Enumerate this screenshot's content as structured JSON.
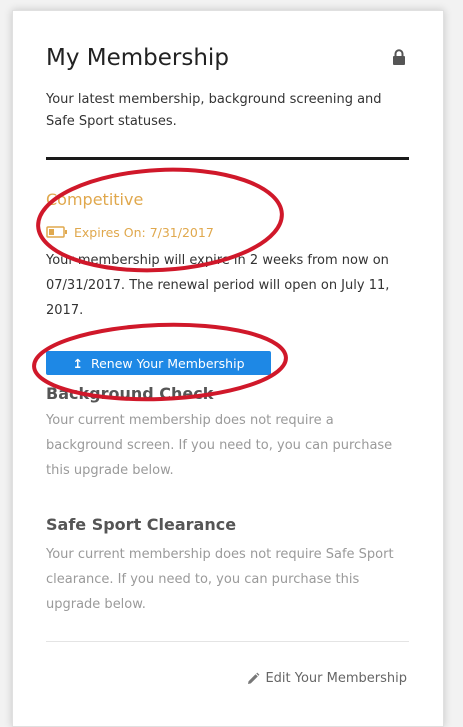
{
  "header": {
    "title": "My Membership",
    "subtitle": "Your latest membership, background screening and Safe Sport statuses."
  },
  "membership": {
    "type": "Competitive",
    "expires_label": "Expires On: 7/31/2017",
    "expire_note": "Your membership will expire in 2 weeks from now on 07/31/2017. The renewal period will open on July 11, 2017.",
    "renew_button_label": "Renew Your Membership",
    "renew_icon": "↥",
    "status_color": "#e0a84d"
  },
  "background_check": {
    "title": "Background Check",
    "body": "Your current membership does not require a background screen. If you need to, you can purchase this upgrade below."
  },
  "safe_sport": {
    "title": "Safe Sport Clearance",
    "body": "Your current membership does not require Safe Sport clearance. If you need to, you can purchase this upgrade below."
  },
  "footer": {
    "edit_label": "Edit Your Membership"
  },
  "icons": {
    "lock": "lock-icon",
    "battery": "battery-low-icon",
    "up_arrow": "up-arrow-icon",
    "pencil": "pencil-icon"
  },
  "colors": {
    "accent_button": "#1e88e5",
    "annotation_red": "#d0182a"
  }
}
